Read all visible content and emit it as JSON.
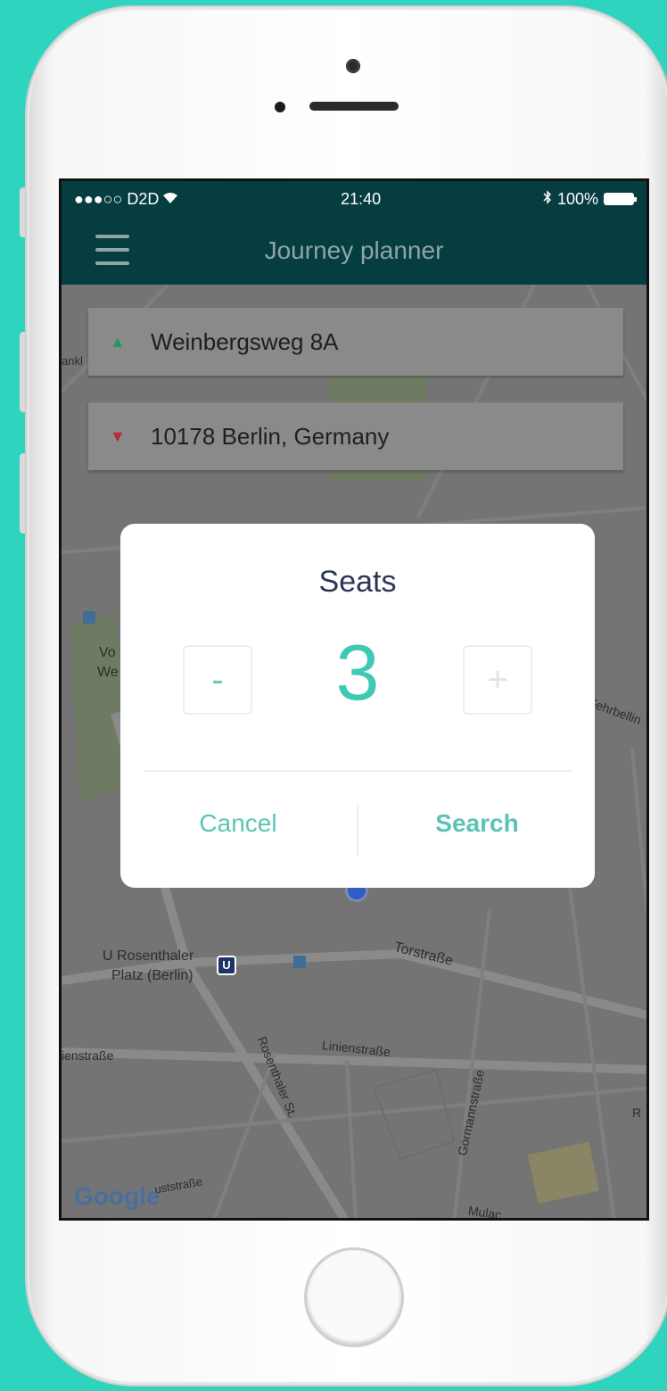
{
  "status_bar": {
    "carrier": "●●●○○ D2D",
    "time": "21:40",
    "battery": "100%"
  },
  "nav": {
    "title": "Journey planner"
  },
  "journey": {
    "origin": "Weinbergsweg 8A",
    "destination": "10178 Berlin, Germany"
  },
  "dialog": {
    "title": "Seats",
    "seats": "3",
    "decrement": "-",
    "increment": "+",
    "cancel": "Cancel",
    "search": "Search"
  },
  "map": {
    "labels": [
      "U Rosenthaler",
      "Platz (Berlin)",
      "Torstraße",
      "Linienstraße",
      "ienstraße",
      "Rosenthaler St.",
      "Gormannstraße",
      "Google",
      "Vo",
      "We",
      "Fehrbellin",
      "ankl",
      "Mulac",
      "R",
      "uststraße"
    ]
  },
  "colors": {
    "accent": "#3fc8b3",
    "navbar": "#063d40",
    "background": "#2fd4be",
    "origin_marker": "#1f9a5f",
    "destination_marker": "#b52b36"
  }
}
